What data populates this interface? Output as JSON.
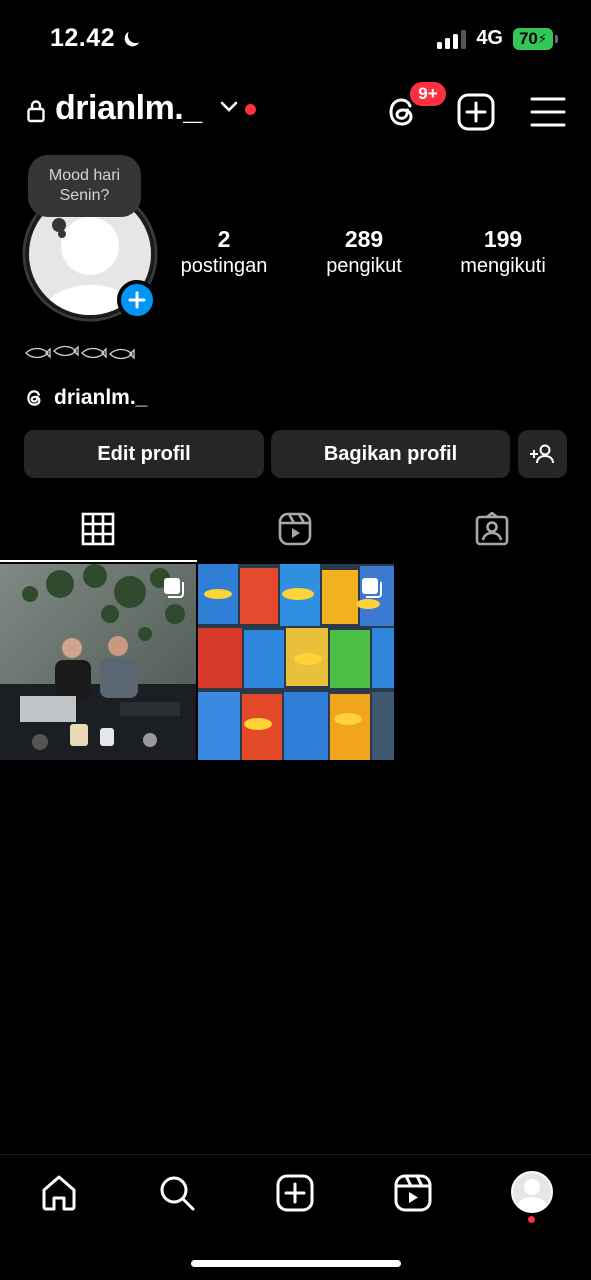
{
  "status_bar": {
    "time": "12.42",
    "network": "4G",
    "battery": "70"
  },
  "header": {
    "username": "drianlm._",
    "notification_badge": "9+"
  },
  "note": {
    "line1": "Mood hari",
    "line2": "Senin?"
  },
  "stats": [
    {
      "value": "2",
      "label": "postingan"
    },
    {
      "value": "289",
      "label": "pengikut"
    },
    {
      "value": "199",
      "label": "mengikuti"
    }
  ],
  "threads_handle": "drianlm._",
  "buttons": {
    "edit": "Edit profil",
    "share": "Bagikan profil"
  },
  "tabs": [
    "grid-icon",
    "reels-icon",
    "tagged-icon"
  ],
  "colors": {
    "background": "#000000",
    "button": "#262626",
    "accent": "#0095f6",
    "badge": "#ff3040",
    "battery": "#33c759"
  }
}
